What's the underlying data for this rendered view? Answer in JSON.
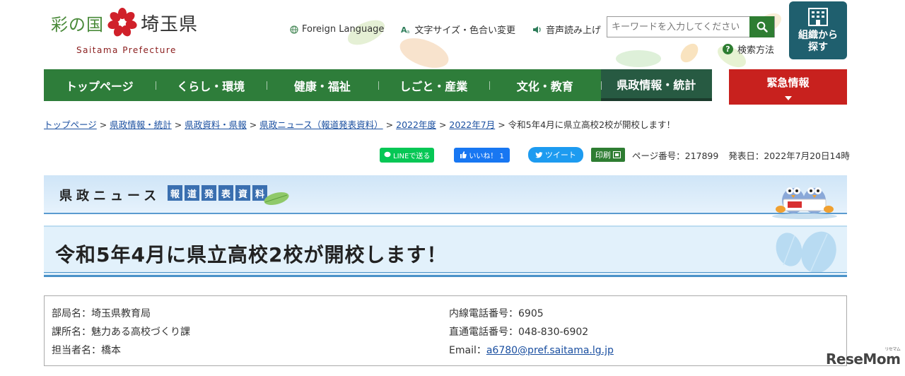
{
  "header": {
    "logo_left": "彩の国",
    "logo_right": "埼玉県",
    "logo_sub": "Saitama Prefecture",
    "tools": [
      {
        "icon": "globe-icon",
        "label": "Foreign Language"
      },
      {
        "icon": "text-size-icon",
        "label": "文字サイズ・色合い変更"
      },
      {
        "icon": "speaker-icon",
        "label": "音声読み上げ"
      }
    ],
    "search_placeholder": "キーワードを入力してください",
    "search_help": "検索方法",
    "org_button": [
      "組織から",
      "探す"
    ]
  },
  "nav": {
    "items": [
      "トップページ",
      "くらし・環境",
      "健康・福祉",
      "しごと・産業",
      "文化・教育",
      "県政情報・統計"
    ],
    "active_index": 5,
    "emergency": "緊急情報"
  },
  "breadcrumb": {
    "links": [
      "トップページ",
      "県政情報・統計",
      "県政資料・県報",
      "県政ニュース（報道発表資料）",
      "2022年度",
      "2022年7月"
    ],
    "current": "令和5年4月に県立高校2校が開校します！"
  },
  "share": {
    "line": "LINEで送る",
    "facebook": "いいね！ 1",
    "twitter": "ツイート",
    "print": "印刷",
    "page_number": "ページ番号：217899",
    "published": "発表日：2022年7月20日14時"
  },
  "news_banner": {
    "title": "県政ニュース",
    "tags": [
      "報",
      "道",
      "発",
      "表",
      "資",
      "料"
    ]
  },
  "page_title": "令和5年4月に県立高校2校が開校します！",
  "contact": {
    "department": "部局名：埼玉県教育局",
    "section": "課所名：魅力ある高校づくり課",
    "person": "担当者名：橋本",
    "extension": "内線電話番号：6905",
    "direct": "直通電話番号：048-830-6902",
    "email_label": "Email：",
    "email": "a6780@pref.saitama.lg.jp"
  },
  "watermark": {
    "main": "ReseMom",
    "sub": "リセマム"
  },
  "colors": {
    "nav_green": "#2e7d3a",
    "nav_active": "#275a42",
    "emergency_red": "#c8211e",
    "org_teal": "#1f5f6e",
    "link_blue": "#1a4fa0",
    "title_bg": "#e2f1fb"
  }
}
